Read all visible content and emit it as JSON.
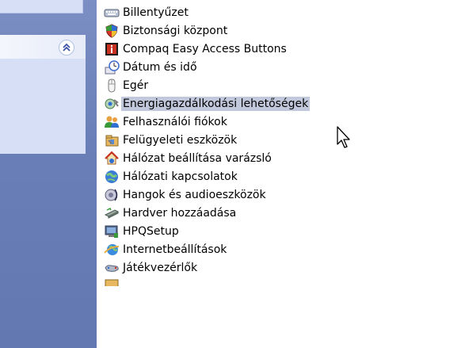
{
  "items": [
    {
      "label": "Billentyűzet",
      "icon": "keyboard-icon"
    },
    {
      "label": "Biztonsági központ",
      "icon": "security-shield-icon"
    },
    {
      "label": "Compaq Easy Access Buttons",
      "icon": "compaq-info-icon"
    },
    {
      "label": "Dátum és idő",
      "icon": "date-time-icon"
    },
    {
      "label": "Egér",
      "icon": "mouse-icon"
    },
    {
      "label": "Energiagazdálkodási lehetőségek",
      "icon": "power-options-icon"
    },
    {
      "label": "Felhasználói fiókok",
      "icon": "user-accounts-icon"
    },
    {
      "label": "Felügyeleti eszközök",
      "icon": "admin-tools-icon"
    },
    {
      "label": "Hálózat beállítása varázsló",
      "icon": "network-wizard-icon"
    },
    {
      "label": "Hálózati kapcsolatok",
      "icon": "network-connections-icon"
    },
    {
      "label": "Hangok és audioeszközök",
      "icon": "sounds-audio-icon"
    },
    {
      "label": "Hardver hozzáadása",
      "icon": "add-hardware-icon"
    },
    {
      "label": "HPQSetup",
      "icon": "hpq-setup-icon"
    },
    {
      "label": "Internetbeállítások",
      "icon": "internet-options-icon"
    },
    {
      "label": "Játékvezérlők",
      "icon": "game-controllers-icon"
    }
  ],
  "hovered_item": "Energiagazdálkodási lehetőségek",
  "left_pane": {
    "collapse_glyph": "»",
    "accent_color": "#6a7fb7"
  }
}
